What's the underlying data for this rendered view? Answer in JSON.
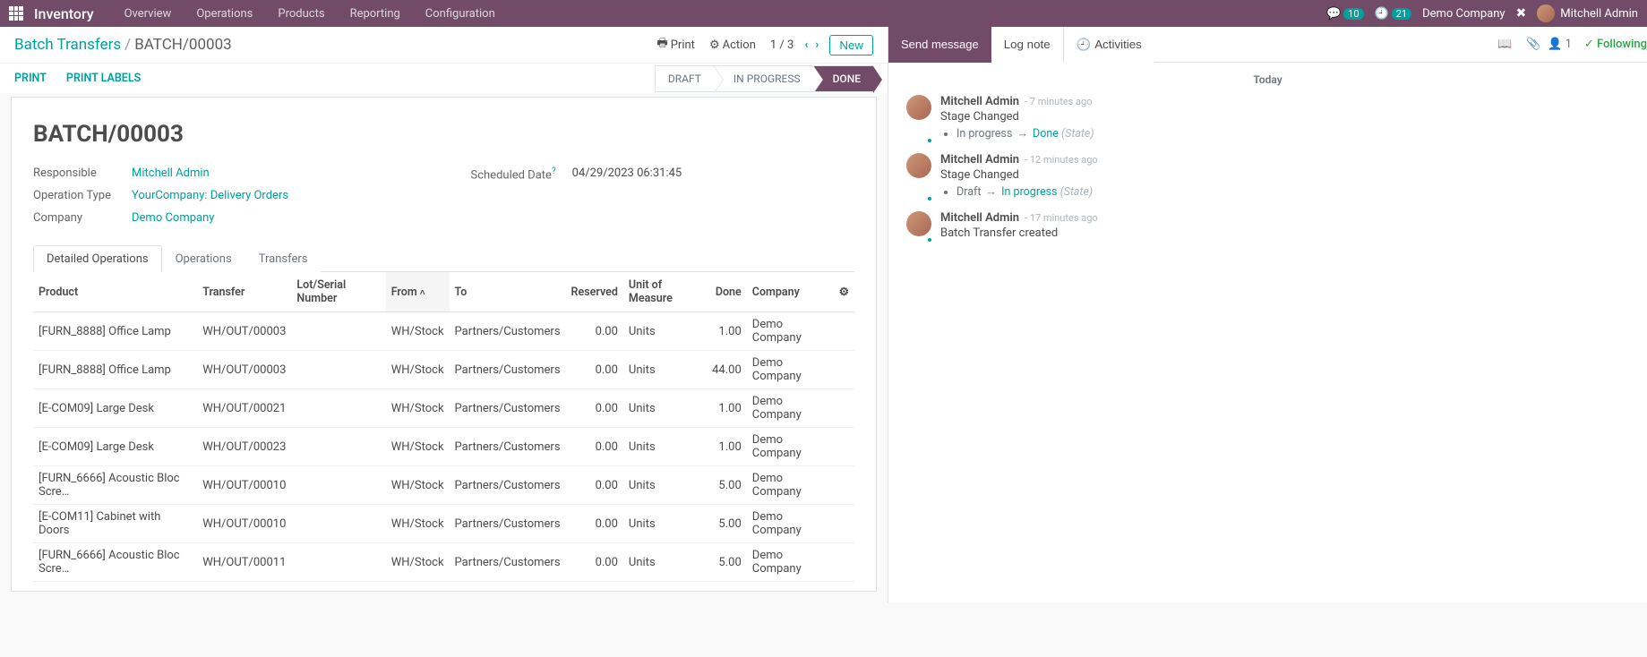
{
  "topbar": {
    "app": "Inventory",
    "nav": [
      "Overview",
      "Operations",
      "Products",
      "Reporting",
      "Configuration"
    ],
    "msg_count": "10",
    "clock_count": "21",
    "company": "Demo Company",
    "user": "Mitchell Admin"
  },
  "breadcrumb": {
    "root": "Batch Transfers",
    "leaf": "BATCH/00003"
  },
  "controlbar": {
    "print": "Print",
    "action": "Action",
    "pager": "1 / 3",
    "new": "New"
  },
  "actionbar": {
    "print": "PRINT",
    "print_labels": "PRINT LABELS",
    "states": [
      "DRAFT",
      "IN PROGRESS",
      "DONE"
    ],
    "active_state_index": 2
  },
  "record": {
    "title": "BATCH/00003",
    "fields": {
      "responsible_label": "Responsible",
      "responsible_value": "Mitchell Admin",
      "optype_label": "Operation Type",
      "optype_value": "YourCompany: Delivery Orders",
      "company_label": "Company",
      "company_value": "Demo Company",
      "scheduled_label": "Scheduled Date",
      "scheduled_value": "04/29/2023 06:31:45"
    }
  },
  "tabs": [
    "Detailed Operations",
    "Operations",
    "Transfers"
  ],
  "columns": {
    "product": "Product",
    "transfer": "Transfer",
    "lot": "Lot/Serial Number",
    "from": "From",
    "to": "To",
    "reserved": "Reserved",
    "uom": "Unit of Measure",
    "done": "Done",
    "company": "Company"
  },
  "rows": [
    {
      "product": "[FURN_8888] Office Lamp",
      "transfer": "WH/OUT/00003",
      "lot": "",
      "from": "WH/Stock",
      "to": "Partners/Customers",
      "reserved": "0.00",
      "uom": "Units",
      "done": "1.00",
      "company": "Demo Company"
    },
    {
      "product": "[FURN_8888] Office Lamp",
      "transfer": "WH/OUT/00003",
      "lot": "",
      "from": "WH/Stock",
      "to": "Partners/Customers",
      "reserved": "0.00",
      "uom": "Units",
      "done": "44.00",
      "company": "Demo Company"
    },
    {
      "product": "[E-COM09] Large Desk",
      "transfer": "WH/OUT/00021",
      "lot": "",
      "from": "WH/Stock",
      "to": "Partners/Customers",
      "reserved": "0.00",
      "uom": "Units",
      "done": "1.00",
      "company": "Demo Company"
    },
    {
      "product": "[E-COM09] Large Desk",
      "transfer": "WH/OUT/00023",
      "lot": "",
      "from": "WH/Stock",
      "to": "Partners/Customers",
      "reserved": "0.00",
      "uom": "Units",
      "done": "1.00",
      "company": "Demo Company"
    },
    {
      "product": "[FURN_6666] Acoustic Bloc Scre…",
      "transfer": "WH/OUT/00010",
      "lot": "",
      "from": "WH/Stock",
      "to": "Partners/Customers",
      "reserved": "0.00",
      "uom": "Units",
      "done": "5.00",
      "company": "Demo Company"
    },
    {
      "product": "[E-COM11] Cabinet with Doors",
      "transfer": "WH/OUT/00010",
      "lot": "",
      "from": "WH/Stock",
      "to": "Partners/Customers",
      "reserved": "0.00",
      "uom": "Units",
      "done": "5.00",
      "company": "Demo Company"
    },
    {
      "product": "[FURN_6666] Acoustic Bloc Scre…",
      "transfer": "WH/OUT/00011",
      "lot": "",
      "from": "WH/Stock",
      "to": "Partners/Customers",
      "reserved": "0.00",
      "uom": "Units",
      "done": "5.00",
      "company": "Demo Company"
    }
  ],
  "chatter": {
    "send": "Send message",
    "log": "Log note",
    "activities": "Activities",
    "follower_count": "1",
    "following": "Following",
    "date_sep": "Today",
    "messages": [
      {
        "author": "Mitchell Admin",
        "time": "7 minutes ago",
        "subject": "Stage Changed",
        "from": "In progress",
        "to": "Done",
        "meta": "(State)"
      },
      {
        "author": "Mitchell Admin",
        "time": "12 minutes ago",
        "subject": "Stage Changed",
        "from": "Draft",
        "to": "In progress",
        "meta": "(State)"
      },
      {
        "author": "Mitchell Admin",
        "time": "17 minutes ago",
        "subject": "Batch Transfer created"
      }
    ]
  }
}
